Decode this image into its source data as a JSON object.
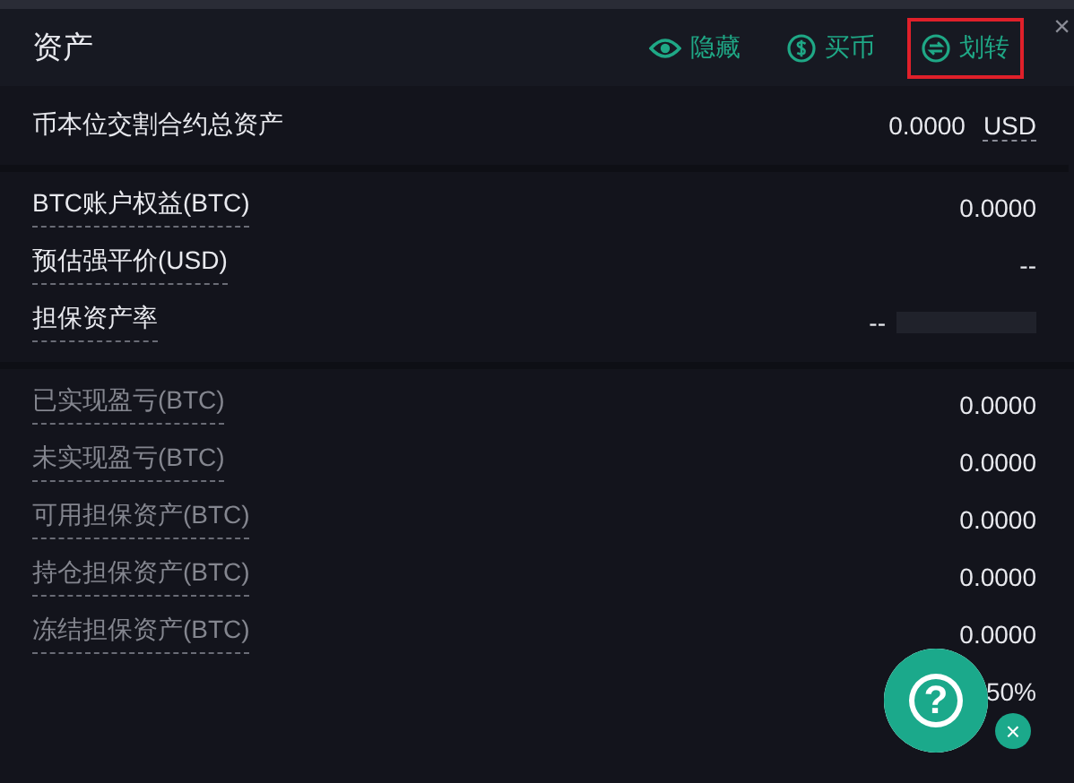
{
  "header": {
    "title": "资产",
    "actions": [
      {
        "kind": "eye",
        "label": "隐藏",
        "highlighted": false
      },
      {
        "kind": "dollar",
        "label": "买币",
        "highlighted": false
      },
      {
        "kind": "transfer",
        "label": "划转",
        "highlighted": true
      }
    ],
    "close": "×"
  },
  "total": {
    "label": "币本位交割合约总资产",
    "value": "0.0000",
    "unit": "USD"
  },
  "sections": [
    {
      "muted": false,
      "rows": [
        {
          "label": "BTC账户权益(BTC)",
          "value": "0.0000"
        },
        {
          "label": "预估强平价(USD)",
          "value": "--"
        },
        {
          "label": "担保资产率",
          "value": "--",
          "masked": true
        }
      ]
    },
    {
      "muted": true,
      "rows": [
        {
          "label": "已实现盈亏(BTC)",
          "value": "0.0000"
        },
        {
          "label": "未实现盈亏(BTC)",
          "value": "0.0000"
        },
        {
          "label": "可用担保资产(BTC)",
          "value": "0.0000"
        },
        {
          "label": "持仓担保资产(BTC)",
          "value": "0.0000"
        },
        {
          "label": "冻结担保资产(BTC)",
          "value": "0.0000"
        },
        {
          "value": "50%"
        }
      ]
    }
  ],
  "help": {
    "symbol": "?",
    "close": "×"
  }
}
